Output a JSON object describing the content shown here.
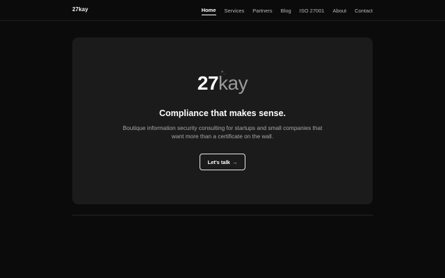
{
  "header": {
    "brand": "27kay",
    "nav": [
      {
        "label": "Home",
        "active": true
      },
      {
        "label": "Services"
      },
      {
        "label": "Partners"
      },
      {
        "label": "Blog"
      },
      {
        "label": "ISO 27001"
      },
      {
        "label": "About"
      },
      {
        "label": "Contact"
      }
    ]
  },
  "hero": {
    "logo_prompt": ">_",
    "logo_number": "27",
    "logo_word": "kay",
    "headline": "Compliance that makes sense.",
    "subtitle": "Boutique information security consulting for startups and small companies that want more than a certificate on the wall.",
    "cta_label": "Let's talk",
    "cta_arrow": "→"
  },
  "colors": {
    "page_bg": "#0b0b0b",
    "card_bg": "#1b1b1b",
    "text_primary": "#ffffff",
    "text_muted": "#a8a8a8"
  }
}
